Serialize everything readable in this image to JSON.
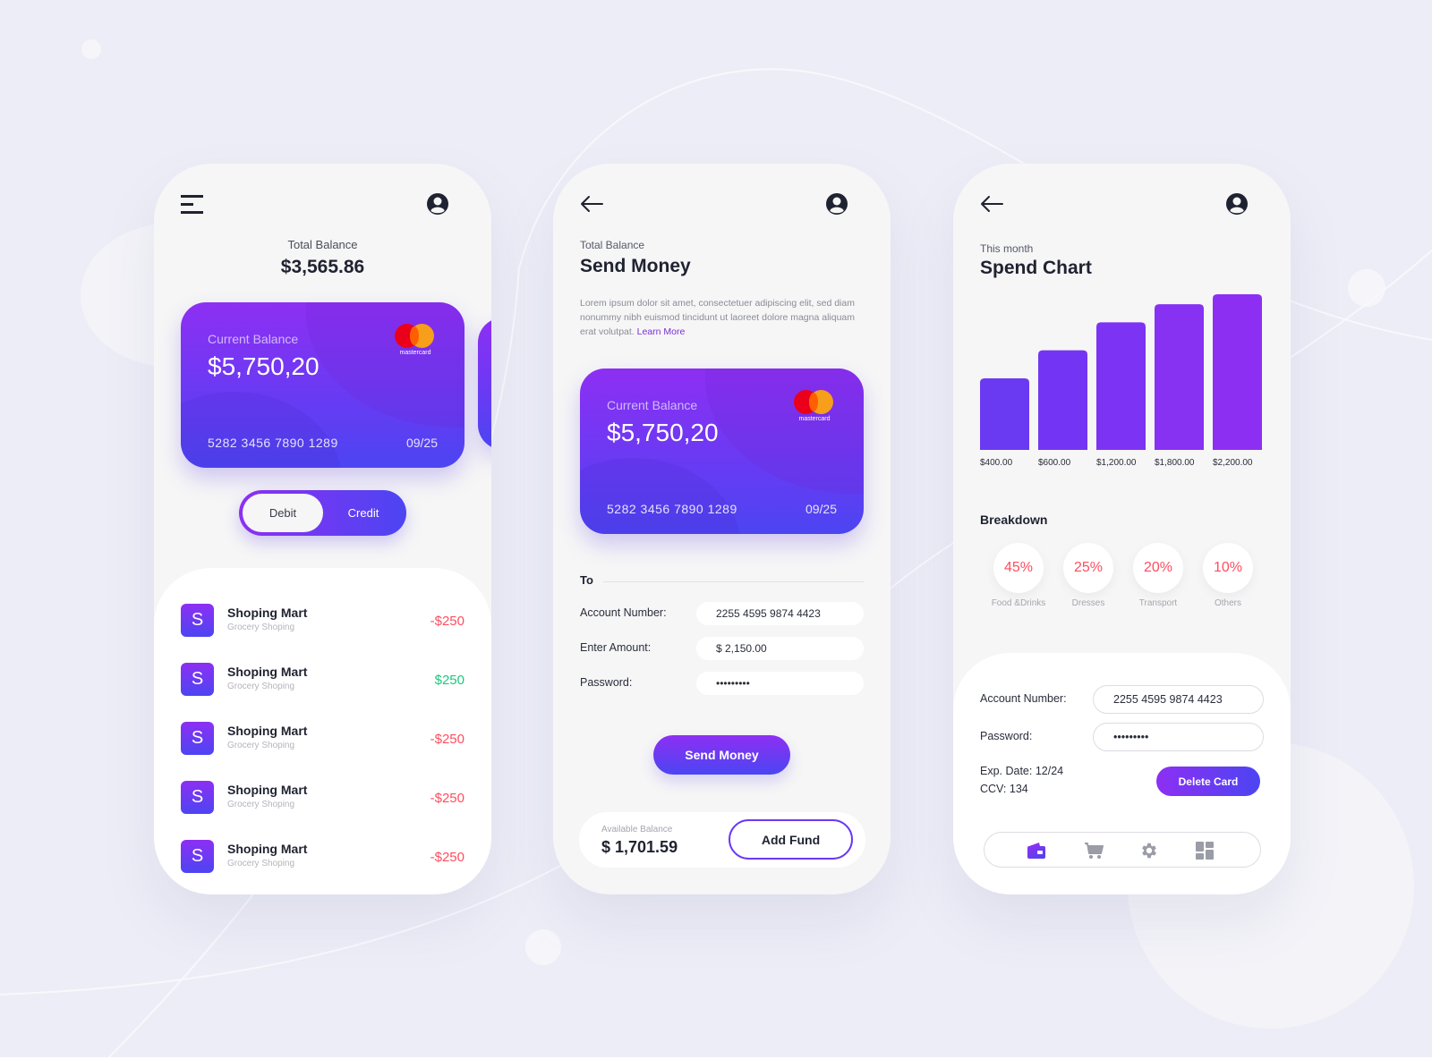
{
  "colors": {
    "background": "#ecedf6",
    "accent_purple": "#8d2ff3",
    "accent_blue": "#4c45f2",
    "negative": "#ff4d5e",
    "positive": "#1fc77e",
    "text_dark": "#1f2230"
  },
  "screen1": {
    "menu_icon": "hamburger-menu-icon",
    "profile_icon": "user-circle-icon",
    "total_balance_label": "Total Balance",
    "total_balance_value": "$3,565.86",
    "card": {
      "label": "Current Balance",
      "balance": "$5,750,20",
      "number": "5282 3456 7890 1289",
      "expiry": "09/25",
      "brand": "mastercard"
    },
    "toggle": {
      "options": [
        "Debit",
        "Credit"
      ],
      "selected": "Debit"
    },
    "transactions": [
      {
        "avatar": "S",
        "name": "Shoping Mart",
        "category": "Grocery Shoping",
        "amount": "-$250",
        "type": "debit"
      },
      {
        "avatar": "S",
        "name": "Shoping Mart",
        "category": "Grocery Shoping",
        "amount": "$250",
        "type": "credit"
      },
      {
        "avatar": "S",
        "name": "Shoping Mart",
        "category": "Grocery Shoping",
        "amount": "-$250",
        "type": "debit"
      },
      {
        "avatar": "S",
        "name": "Shoping Mart",
        "category": "Grocery Shoping",
        "amount": "-$250",
        "type": "debit"
      },
      {
        "avatar": "S",
        "name": "Shoping Mart",
        "category": "Grocery Shoping",
        "amount": "-$250",
        "type": "debit"
      }
    ]
  },
  "screen2": {
    "back_icon": "arrow-left-icon",
    "profile_icon": "user-circle-icon",
    "label": "Total Balance",
    "title": "Send Money",
    "description": "Lorem ipsum dolor sit amet, consectetuer adipiscing elit, sed diam nonummy nibh euismod tincidunt ut laoreet dolore magna aliquam erat volutpat.",
    "learn_more": "Learn More",
    "card": {
      "label": "Current Balance",
      "balance": "$5,750,20",
      "number": "5282 3456 7890 1289",
      "expiry": "09/25",
      "brand": "mastercard"
    },
    "to_label": "To",
    "form": {
      "account_label": "Account Number:",
      "account_value": "2255 4595 9874 4423",
      "amount_label": "Enter Amount:",
      "amount_value": "$ 2,150.00",
      "password_label": "Password:",
      "password_value": "•••••••••"
    },
    "send_button": "Send Money",
    "available_label": "Available Balance",
    "available_value": "$ 1,701.59",
    "add_fund_button": "Add Fund"
  },
  "screen3": {
    "back_icon": "arrow-left-icon",
    "profile_icon": "user-circle-icon",
    "label": "This month",
    "title": "Spend Chart",
    "breakdown_title": "Breakdown",
    "breakdown": [
      {
        "percent": "45%",
        "label": "Food &Drinks"
      },
      {
        "percent": "25%",
        "label": "Dresses"
      },
      {
        "percent": "20%",
        "label": "Transport"
      },
      {
        "percent": "10%",
        "label": "Others"
      }
    ],
    "form": {
      "account_label": "Account Number:",
      "account_value": "2255 4595 9874 4423",
      "password_label": "Password:",
      "password_value": "•••••••••"
    },
    "exp_date": "Exp. Date: 12/24",
    "ccv": "CCV: 134",
    "delete_button": "Delete Card",
    "nav": [
      {
        "icon": "wallet-icon",
        "active": true
      },
      {
        "icon": "cart-icon",
        "active": false
      },
      {
        "icon": "gear-icon",
        "active": false
      },
      {
        "icon": "dashboard-icon",
        "active": false
      }
    ]
  },
  "chart_data": {
    "type": "bar",
    "title": "Spend Chart",
    "subtitle": "This month",
    "categories": [
      "$400.00",
      "$600.00",
      "$1,200.00",
      "$1,800.00",
      "$2,200.00"
    ],
    "values": [
      400,
      600,
      1200,
      1800,
      2200
    ],
    "xlabel": "",
    "ylabel": "",
    "grid": false,
    "legend": "none"
  }
}
